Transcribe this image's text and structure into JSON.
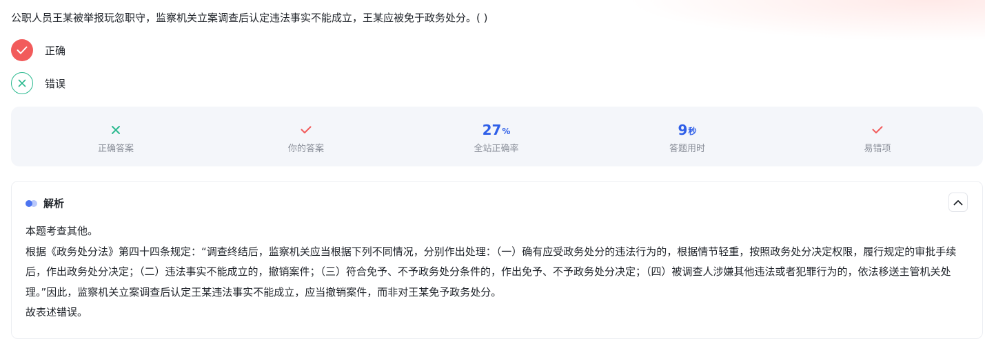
{
  "question": {
    "text": "公职人员王某被举报玩忽职守，监察机关立案调查后认定违法事实不能成立，王某应被免于政务处分。( )"
  },
  "options": [
    {
      "label": "正确",
      "state": "selected",
      "icon": "check-icon"
    },
    {
      "label": "错误",
      "state": "correct",
      "icon": "x-icon"
    }
  ],
  "stats": {
    "correct_answer": {
      "label": "正确答案",
      "icon": "x-icon",
      "color": "#2ab98f"
    },
    "your_answer": {
      "label": "你的答案",
      "icon": "check-icon",
      "color": "#f25b5b"
    },
    "accuracy": {
      "value": "27",
      "unit": "%",
      "label": "全站正确率"
    },
    "time": {
      "value": "9",
      "unit": "秒",
      "label": "答题用时"
    },
    "common_wrong": {
      "label": "易错项",
      "icon": "check-icon",
      "color": "#f25b5b"
    }
  },
  "analysis": {
    "title": "解析",
    "paragraphs": [
      "本题考查其他。",
      "根据《政务处分法》第四十四条规定：“调查终结后，监察机关应当根据下列不同情况，分别作出处理：（一）确有应受政务处分的违法行为的，根据情节轻重，按照政务处分决定权限，履行规定的审批手续后，作出政务处分决定；（二）违法事实不能成立的，撤销案件；（三）符合免予、不予政务处分条件的，作出免予、不予政务处分决定；（四）被调查人涉嫌其他违法或者犯罪行为的，依法移送主管机关处理。”因此，监察机关立案调查后认定王某违法事实不能成立，应当撤销案件，而非对王某免予政务处分。",
      "故表述错误。"
    ]
  },
  "colors": {
    "accent_blue": "#2f5fe8",
    "wrong_red": "#f25b5b",
    "correct_green": "#2ab98f"
  }
}
